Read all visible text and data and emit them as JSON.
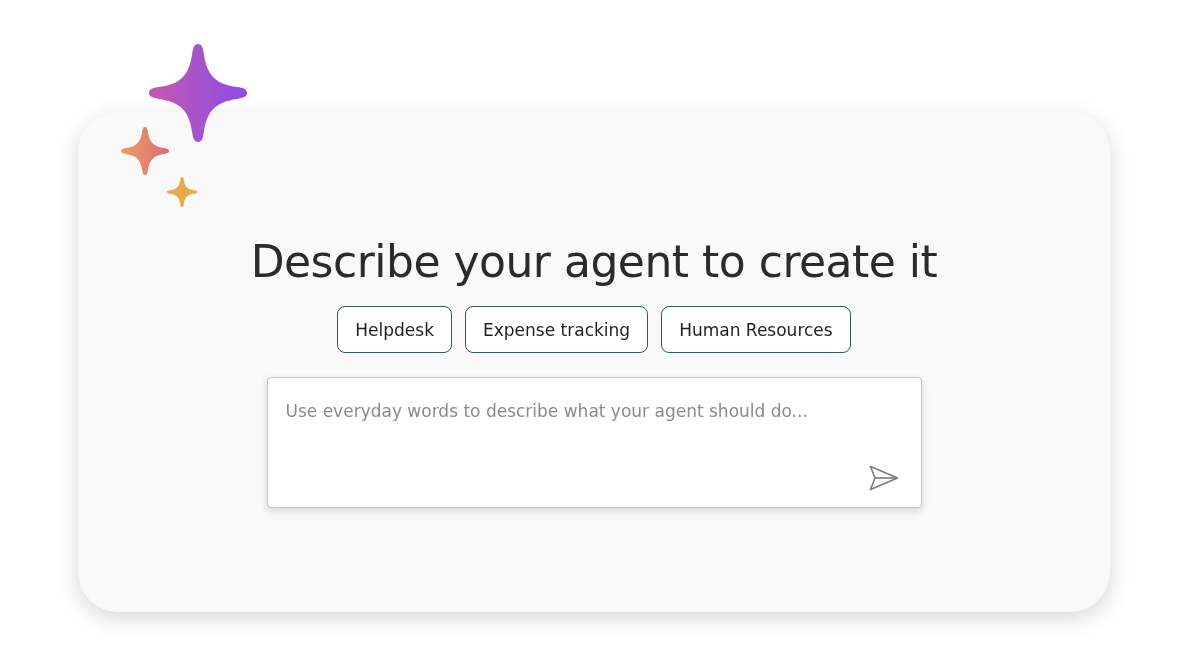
{
  "title": "Describe your agent to create it",
  "suggestions": [
    {
      "label": "Helpdesk"
    },
    {
      "label": "Expense tracking"
    },
    {
      "label": "Human Resources"
    }
  ],
  "prompt": {
    "placeholder": "Use everyday words to describe what your agent should do..."
  }
}
